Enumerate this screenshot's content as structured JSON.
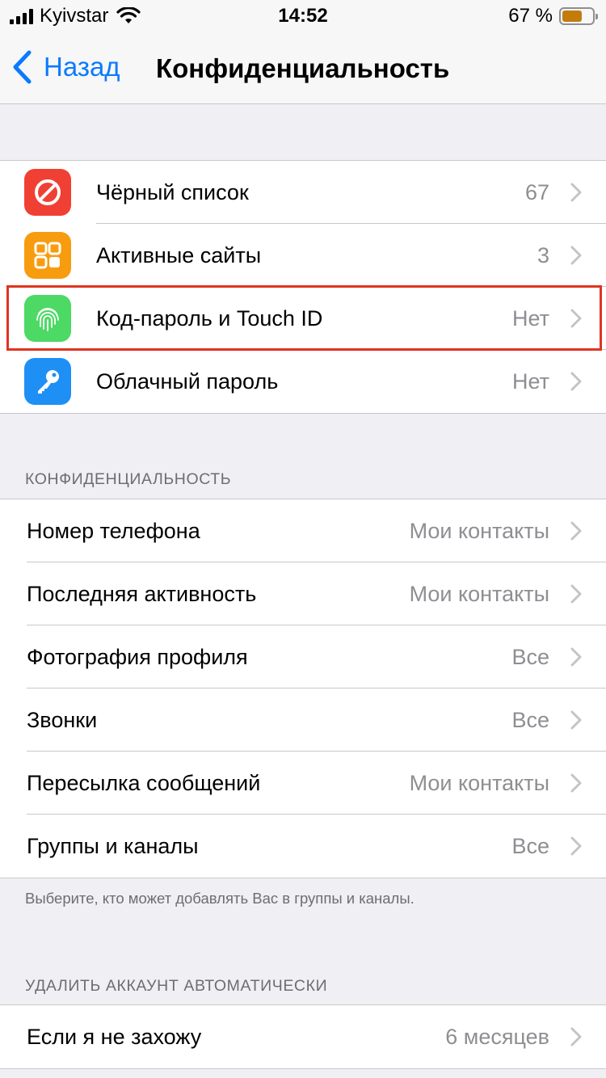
{
  "status_bar": {
    "carrier": "Kyivstar",
    "time": "14:52",
    "battery_percent": "67 %",
    "battery_level": 0.67,
    "signal_icon": "signal-bars-icon",
    "wifi_icon": "wifi-icon",
    "battery_icon": "battery-icon"
  },
  "nav": {
    "back_label": "Назад",
    "back_icon": "chevron-left-icon",
    "title": "Конфиденциальность"
  },
  "security": {
    "items": [
      {
        "label": "Чёрный список",
        "value": "67",
        "icon": "blocked-icon",
        "icon_color": "#f04034"
      },
      {
        "label": "Активные сайты",
        "value": "3",
        "icon": "grid-icon",
        "icon_color": "#f79c0f"
      },
      {
        "label": "Код-пароль и Touch ID",
        "value": "Нет",
        "icon": "fingerprint-icon",
        "icon_color": "#4cd964"
      },
      {
        "label": "Облачный пароль",
        "value": "Нет",
        "icon": "key-icon",
        "icon_color": "#1e90f5"
      }
    ]
  },
  "privacy": {
    "header": "КОНФИДЕНЦИАЛЬНОСТЬ",
    "items": [
      {
        "label": "Номер телефона",
        "value": "Мои контакты"
      },
      {
        "label": "Последняя активность",
        "value": "Мои контакты"
      },
      {
        "label": "Фотография профиля",
        "value": "Все"
      },
      {
        "label": "Звонки",
        "value": "Все"
      },
      {
        "label": "Пересылка сообщений",
        "value": "Мои контакты"
      },
      {
        "label": "Группы и каналы",
        "value": "Все"
      }
    ],
    "footer": "Выберите, кто может добавлять Вас в группы и каналы."
  },
  "delete_account": {
    "header": "УДАЛИТЬ АККАУНТ АВТОМАТИЧЕСКИ",
    "items": [
      {
        "label": "Если я не захожу",
        "value": "6 месяцев"
      }
    ]
  },
  "colors": {
    "accent": "#0a7aff",
    "highlight": "#e0341f",
    "background": "#efeff4"
  }
}
